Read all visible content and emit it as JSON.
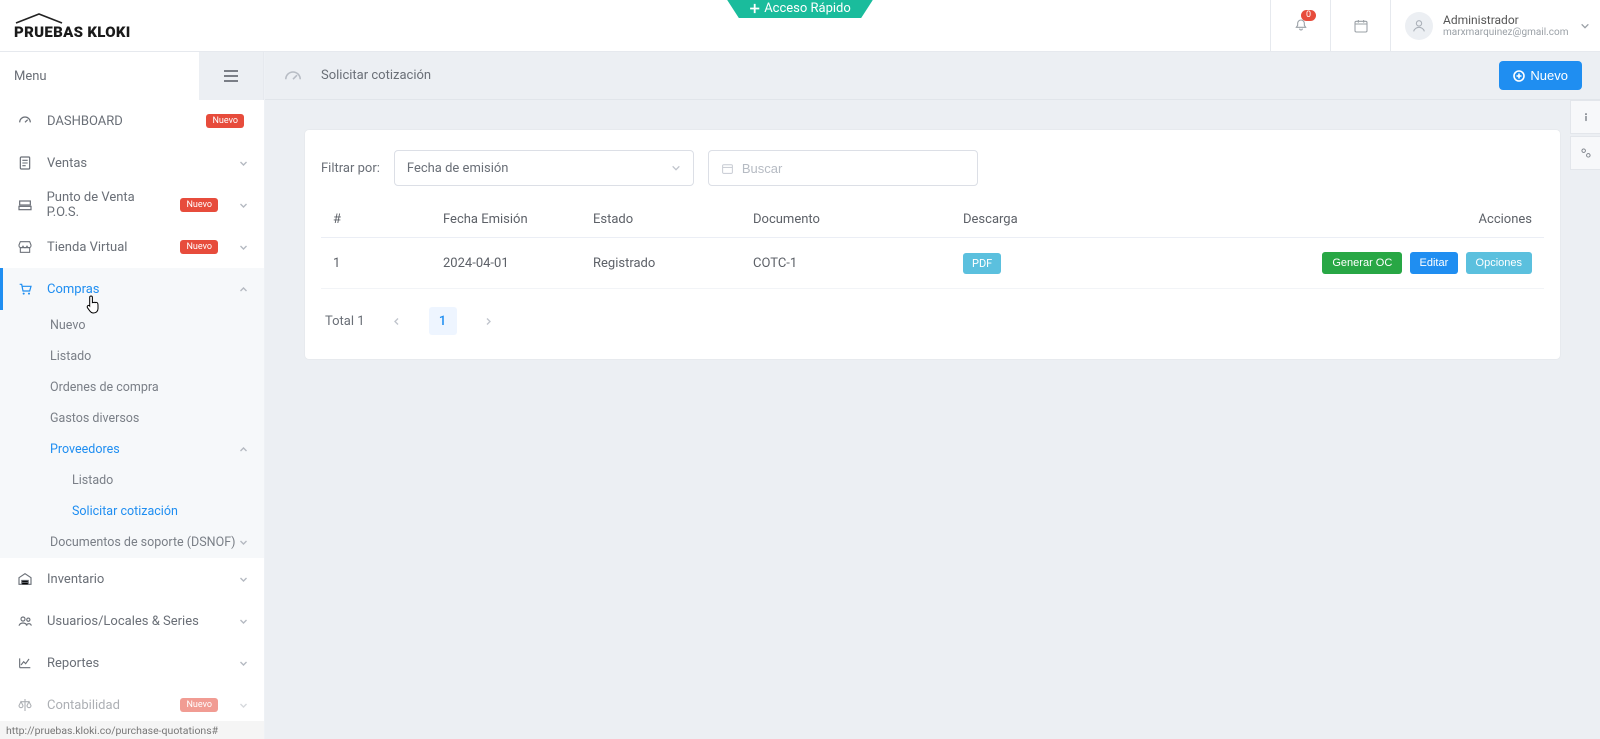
{
  "topbar": {
    "logo_text": "PRUEBAS KLOKI",
    "quick_access": "Acceso Rápido",
    "notif_count": "0",
    "user_name": "Administrador",
    "user_mail": "marxmarquinez@gmail.com"
  },
  "sidebar": {
    "title": "Menu",
    "badge_new": "Nuevo",
    "items": {
      "dashboard": "DASHBOARD",
      "ventas": "Ventas",
      "pos": "Punto de Venta P.O.S.",
      "tienda": "Tienda Virtual",
      "compras": "Compras",
      "inventario": "Inventario",
      "usuarios": "Usuarios/Locales & Series",
      "reportes": "Reportes",
      "contabilidad": "Contabilidad"
    },
    "compras_sub": {
      "nuevo": "Nuevo",
      "listado": "Listado",
      "orden": "Ordenes de compra",
      "gastos": "Gastos diversos",
      "prov": "Proveedores",
      "prov_listado": "Listado",
      "prov_solicitar": "Solicitar cotización",
      "dsnof": "Documentos de soporte (DSNOF)"
    },
    "statusbar": "http://pruebas.kloki.co/purchase-quotations#"
  },
  "crumb": {
    "title": "Solicitar cotización",
    "btn_new": "Nuevo"
  },
  "filter": {
    "label": "Filtrar por:",
    "date": "Fecha de emisión",
    "search_placeholder": "Buscar"
  },
  "table": {
    "headers": {
      "n": "#",
      "fecha": "Fecha Emisión",
      "estado": "Estado",
      "doc": "Documento",
      "descarga": "Descarga",
      "acc": "Acciones"
    },
    "rows": [
      {
        "n": "1",
        "fecha": "2024-04-01",
        "estado": "Registrado",
        "doc": "COTC-1",
        "pdf": "PDF"
      }
    ],
    "actions": {
      "gen": "Generar OC",
      "edit": "Editar",
      "opt": "Opciones"
    }
  },
  "pager": {
    "total": "Total 1",
    "page": "1"
  }
}
